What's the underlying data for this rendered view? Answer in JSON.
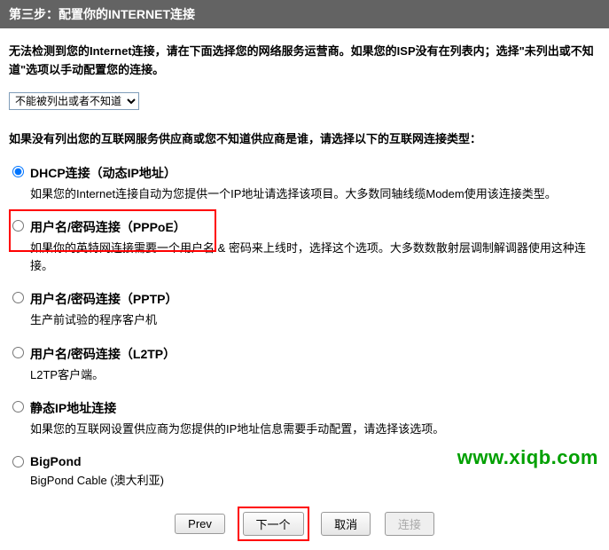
{
  "header": {
    "title": "第三步：配置你的INTERNET连接"
  },
  "instruction": "无法检测到您的Internet连接，请在下面选择您的网络服务运营商。如果您的ISP没有在列表内；选择\"未列出或不知道\"选项以手动配置您的连接。",
  "dropdown": {
    "selected": "不能被列出或者不知道"
  },
  "subtitle": "如果没有列出您的互联网服务供应商或您不知道供应商是谁，请选择以下的互联网连接类型：",
  "options": [
    {
      "title": "DHCP连接（动态IP地址）",
      "desc": "如果您的Internet连接自动为您提供一个IP地址请选择该项目。大多数同轴线缆Modem使用该连接类型。"
    },
    {
      "title": "用户名/密码连接（PPPoE）",
      "desc": "如果你的英特网连接需要一个用户名 & 密码来上线时，选择这个选项。大多数数散射层调制解调器使用这种连接。"
    },
    {
      "title": "用户名/密码连接（PPTP）",
      "desc": "生产前试验的程序客户机"
    },
    {
      "title": "用户名/密码连接（L2TP）",
      "desc": "L2TP客户端。"
    },
    {
      "title": "静态IP地址连接",
      "desc": "如果您的互联网设置供应商为您提供的IP地址信息需要手动配置，请选择该选项。"
    },
    {
      "title": "BigPond",
      "desc": "BigPond Cable (澳大利亚)"
    }
  ],
  "buttons": {
    "prev": "Prev",
    "next": "下一个",
    "cancel": "取消",
    "connect": "连接"
  },
  "watermark": "www.xiqb.com"
}
